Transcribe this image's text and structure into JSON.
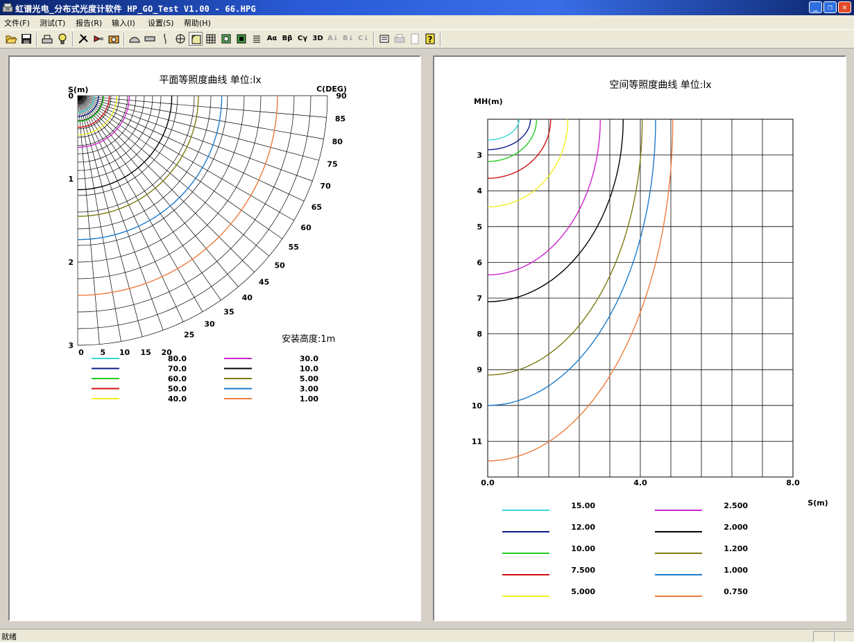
{
  "window": {
    "title": "虹谱光电_分布式光度计软件 HP_GO_Test V1.00 - 66.HPG"
  },
  "menu": [
    {
      "label": "文件(F)"
    },
    {
      "label": "测试(T)"
    },
    {
      "label": "报告(R)"
    },
    {
      "label": "输入(I)"
    },
    {
      "label": "设置(S)"
    },
    {
      "label": "帮助(H)"
    }
  ],
  "toolbar": {
    "buttons": [
      {
        "icon": "open-folder-icon"
      },
      {
        "icon": "save-disk-icon"
      },
      {
        "icon": "measure-icon"
      },
      {
        "icon": "lamp-icon"
      },
      {
        "icon": "tools-icon"
      },
      {
        "icon": "lamp-direction-icon"
      },
      {
        "icon": "photometer-icon"
      },
      {
        "icon": "luminance-icon"
      },
      {
        "icon": "bar-icon"
      },
      {
        "icon": "curve-icon"
      },
      {
        "icon": "globe-icon"
      },
      {
        "icon": "isoilluminance-icon",
        "pressed": true
      },
      {
        "icon": "grid-icon"
      },
      {
        "icon": "box-icon"
      },
      {
        "icon": "box2-icon"
      },
      {
        "icon": "stack-icon"
      },
      {
        "icon": "text-button",
        "text": "Aα"
      },
      {
        "icon": "text-button",
        "text": "Bβ"
      },
      {
        "icon": "text-button",
        "text": "Cγ"
      },
      {
        "icon": "text-button",
        "text": "3D"
      },
      {
        "icon": "text-button",
        "text": "A↓",
        "disabled": true
      },
      {
        "icon": "text-button",
        "text": "B↓",
        "disabled": true
      },
      {
        "icon": "text-button",
        "text": "C↓",
        "disabled": true
      },
      {
        "icon": "report-icon"
      },
      {
        "icon": "print-icon",
        "disabled": true
      },
      {
        "icon": "preview-icon",
        "disabled": true
      },
      {
        "icon": "help-icon"
      }
    ]
  },
  "status": {
    "text": "就绪"
  },
  "chart_data": [
    {
      "type": "polar-isolux",
      "title": "平面等照度曲线  单位:lx",
      "radius_label": "S(m)",
      "angle_label": "C(DEG)",
      "radius_ticks": [
        0,
        1,
        2,
        3
      ],
      "angle_ticks_bottom": [
        0,
        5,
        10,
        15,
        20
      ],
      "angle_ticks_arc": [
        25,
        30,
        35,
        40,
        45,
        50,
        55,
        60,
        65,
        70,
        75,
        80,
        85,
        90
      ],
      "install_height_label": "安装高度:1m",
      "radius_range": [
        0,
        3
      ],
      "angle_range_deg": [
        0,
        90
      ],
      "series": [
        {
          "name": "80.0",
          "color": "#33d6d6",
          "r": 0.2
        },
        {
          "name": "70.0",
          "color": "#0a1a8c",
          "r": 0.25
        },
        {
          "name": "60.0",
          "color": "#22cc22",
          "r": 0.31
        },
        {
          "name": "50.0",
          "color": "#d01010",
          "r": 0.38
        },
        {
          "name": "40.0",
          "color": "#f0f020",
          "r": 0.47
        },
        {
          "name": "30.0",
          "color": "#cc22cc",
          "r": 0.62
        },
        {
          "name": "10.0",
          "color": "#000000",
          "r": 1.13
        },
        {
          "name": "5.00",
          "color": "#7a7a10",
          "r": 1.45
        },
        {
          "name": "3.00",
          "color": "#1a7acc",
          "r": 1.73
        },
        {
          "name": "1.00",
          "color": "#ee7a3c",
          "r": 2.4
        }
      ]
    },
    {
      "type": "space-isolux",
      "title": "空间等照度曲线  单位:lx",
      "ylabel": "MH(m)",
      "xlabel": "S(m)",
      "y_ticks": [
        3,
        4,
        5,
        6,
        7,
        8,
        9,
        10,
        11
      ],
      "x_ticks": [
        "0.0",
        "4.0",
        "8.0"
      ],
      "xlim": [
        0,
        8
      ],
      "ylim": [
        2,
        12
      ],
      "series": [
        {
          "name": "15.00",
          "color": "#33d6d6",
          "s": 0.82,
          "h": 2.58
        },
        {
          "name": "12.00",
          "color": "#0a1a8c",
          "s": 1.12,
          "h": 2.85
        },
        {
          "name": "10.00",
          "color": "#22cc22",
          "s": 1.28,
          "h": 3.18
        },
        {
          "name": "7.500",
          "color": "#d01010",
          "s": 1.65,
          "h": 3.65
        },
        {
          "name": "5.000",
          "color": "#f0f020",
          "s": 2.1,
          "h": 4.45
        },
        {
          "name": "2.500",
          "color": "#cc22cc",
          "s": 2.95,
          "h": 6.35
        },
        {
          "name": "2.000",
          "color": "#000000",
          "s": 3.55,
          "h": 7.1
        },
        {
          "name": "1.200",
          "color": "#7a7a10",
          "s": 4.05,
          "h": 9.15
        },
        {
          "name": "1.000",
          "color": "#1a7acc",
          "s": 4.4,
          "h": 10.0
        },
        {
          "name": "0.750",
          "color": "#ee7a3c",
          "s": 4.85,
          "h": 11.55
        }
      ]
    }
  ]
}
